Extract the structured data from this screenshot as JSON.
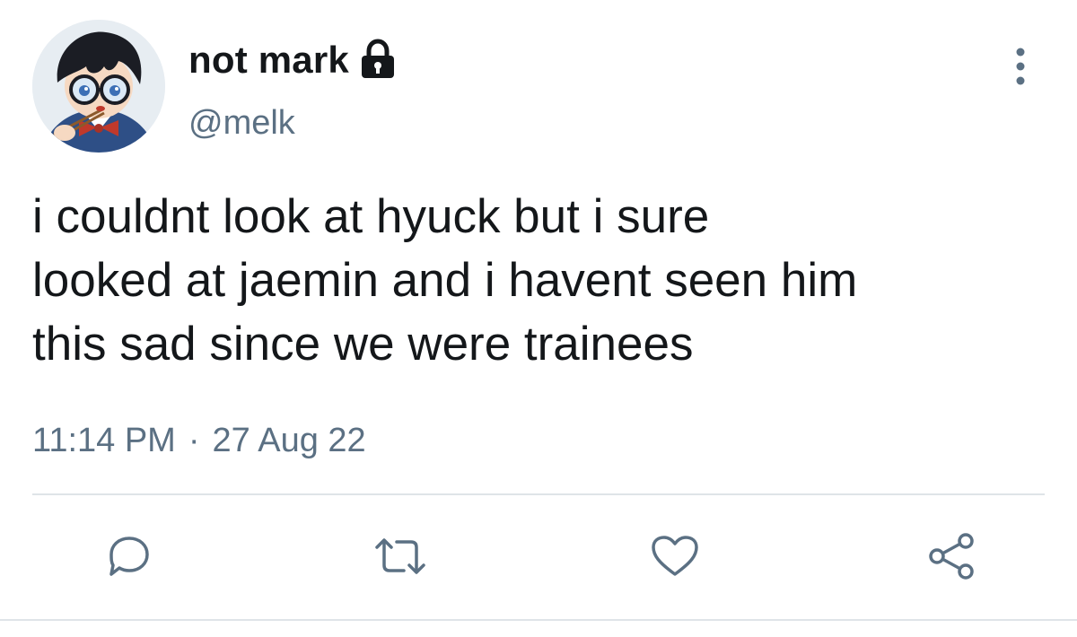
{
  "tweet": {
    "author": {
      "display_name": "not mark",
      "handle": "@melk",
      "protected_icon": "lock-icon",
      "avatar": "avatar-image"
    },
    "menu_icon": "more-vertical-icon",
    "text_lines": [
      "i couldnt look at hyuck but i sure",
      "looked at jaemin and i havent seen him",
      "this sad since we were trainees"
    ],
    "time": "11:14 PM",
    "separator": "·",
    "date": "27 Aug 22"
  },
  "actions": [
    {
      "icon": "reply-icon"
    },
    {
      "icon": "retweet-icon"
    },
    {
      "icon": "like-icon"
    },
    {
      "icon": "share-icon"
    }
  ],
  "colors": {
    "text": "#14171a",
    "secondary_text": "#5b7083",
    "divider": "#dfe4e8",
    "background": "#ffffff"
  }
}
